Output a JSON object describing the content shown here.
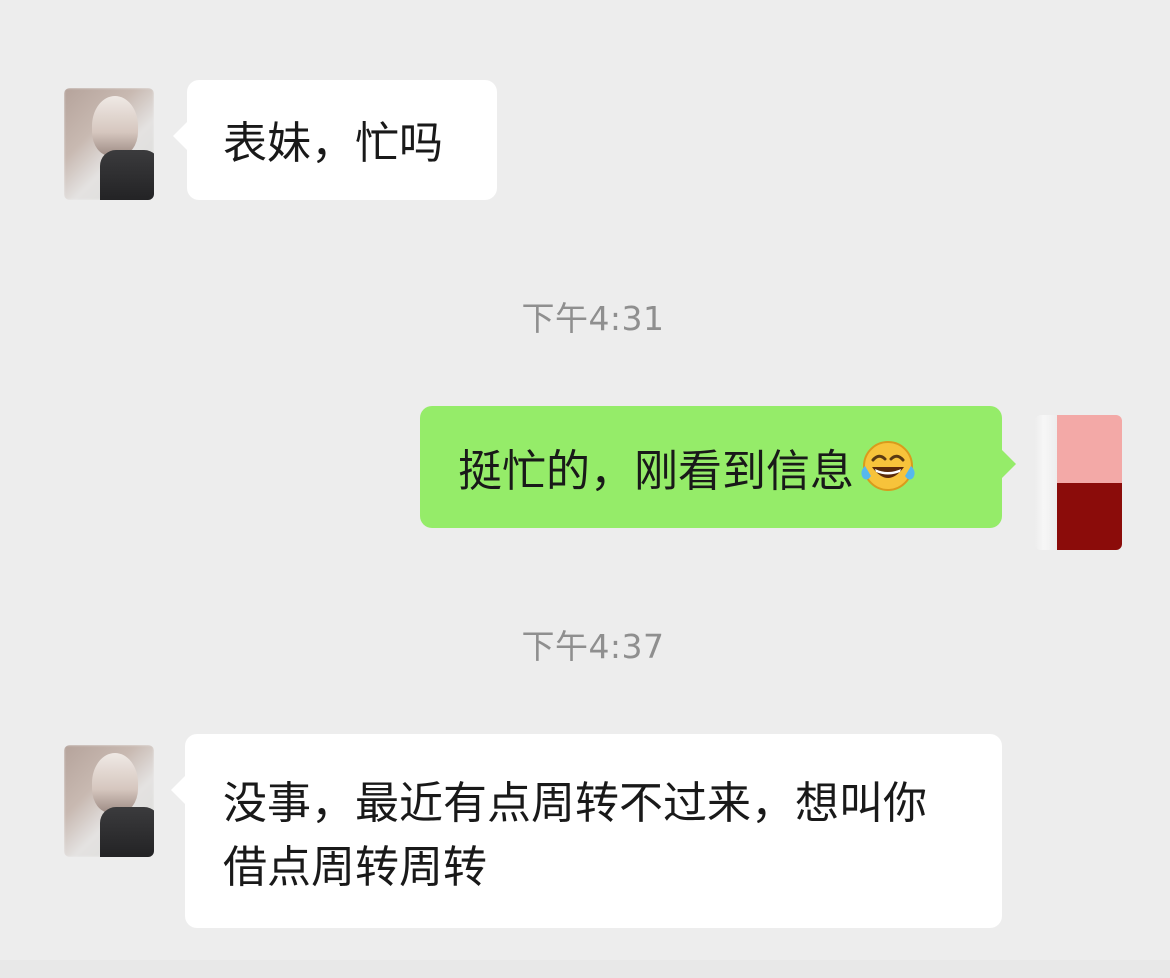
{
  "chat": {
    "timestamps": [
      "下午4:31",
      "下午4:37"
    ],
    "messages": [
      {
        "side": "left",
        "text": "表妹，忙吗"
      },
      {
        "side": "right",
        "text": "挺忙的，刚看到信息",
        "emoji": "face-with-tears-of-joy"
      },
      {
        "side": "left",
        "text": "没事，最近有点周转不过来，想叫你借点周转周转"
      }
    ]
  },
  "colors": {
    "background": "#ededed",
    "incoming_bubble": "#ffffff",
    "outgoing_bubble": "#95ec69",
    "timestamp_text": "#8f8f8f"
  }
}
